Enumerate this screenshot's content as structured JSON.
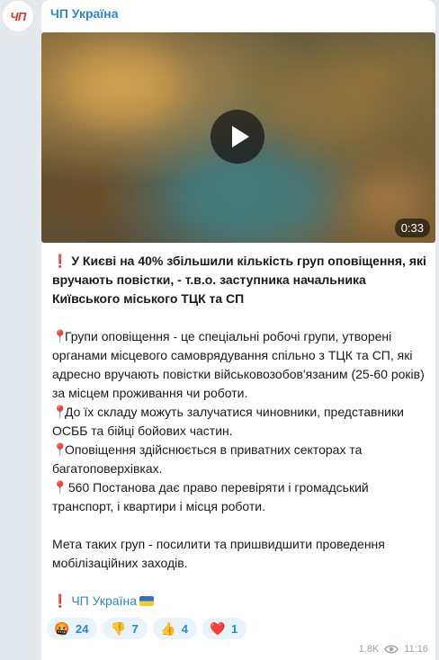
{
  "channel": {
    "avatar_text": "ЧП",
    "name": "ЧП Україна"
  },
  "video": {
    "duration": "0:33",
    "play_icon": "play-icon"
  },
  "post": {
    "headline": "У Києві на 40% збільшили кількість груп оповіщення, які вручають повістки, - т.в.о. заступника начальника Київського міського ТЦК та СП",
    "paragraphs": [
      "Групи оповіщення - це спеціальні робочі групи, утворені органами місцевого самоврядування спільно з ТЦК та СП, які адресно вручають повістки військовозобов'язаним (25-60 років) за місцем проживання чи роботи.",
      "До їх складу можуть залучатися чиновники, представники ОСББ та бійці бойових частин.",
      "Оповіщення здійснюється в приватних секторах та багатоповерхівках.",
      " 560 Постанова дає право перевіряти і громадський транспорт, і квартири і місця роботи."
    ],
    "conclusion": "Мета таких груп - посилити та пришвидшити проведення мобілізаційних заходів.",
    "signature": "ЧП Україна"
  },
  "reactions": [
    {
      "emoji": "🤬",
      "count": "24"
    },
    {
      "emoji": "👎",
      "count": "7"
    },
    {
      "emoji": "👍",
      "count": "4"
    },
    {
      "emoji": "❤️",
      "count": "1"
    }
  ],
  "meta": {
    "views": "1.8K",
    "time": "11:16",
    "views_icon": "eye-icon"
  }
}
